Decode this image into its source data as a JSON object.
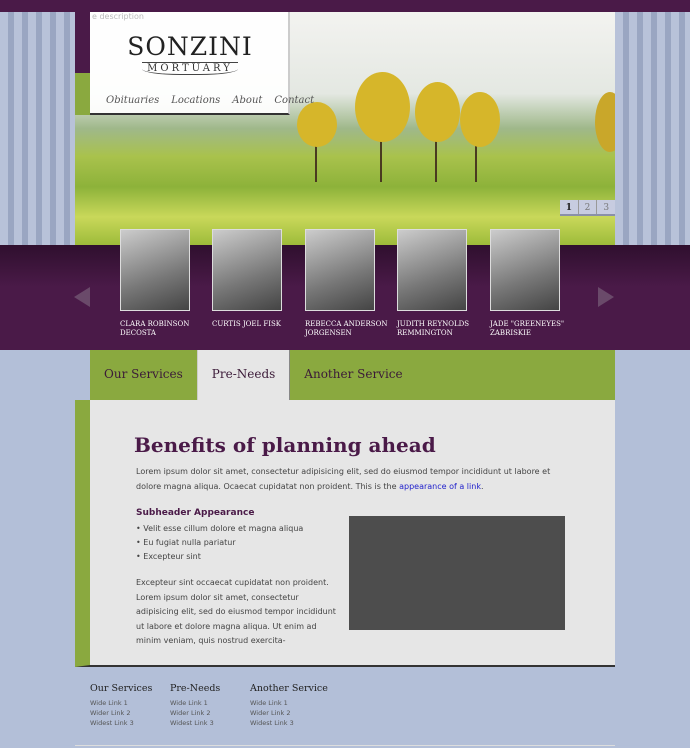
{
  "header": {
    "site_description": "e description",
    "logo_name": "SONZINI",
    "logo_sub": "MORTUARY",
    "nav": [
      "Obituaries",
      "Locations",
      "About",
      "Contact"
    ]
  },
  "slider": {
    "pages": [
      "1",
      "2",
      "3"
    ],
    "current_page": 1
  },
  "obituaries": [
    {
      "name": "CLARA ROBINSON DECOSTA"
    },
    {
      "name": "CURTIS JOEL FISK"
    },
    {
      "name": "REBECCA ANDERSON JORGENSEN"
    },
    {
      "name": "JUDITH REYNOLDS REMMINGTON"
    },
    {
      "name": "JADE \"GREENEYES\" ZABRISKIE"
    }
  ],
  "tabs": [
    {
      "label": "Our Services"
    },
    {
      "label": "Pre-Needs",
      "active": true
    },
    {
      "label": "Another Service"
    }
  ],
  "content": {
    "title": "Benefits of planning ahead",
    "intro": "Lorem ipsum dolor sit amet, consectetur adipisicing elit, sed do eiusmod tempor incididunt ut labore et dolore magna aliqua. Ocaecat cupidatat non proident. This is the ",
    "link": "appearance of a link",
    "intro_end": ".",
    "subheader": "Subheader Appearance",
    "bullets": [
      "• Velit esse cillum dolore et magna aliqua",
      "• Eu fugiat nulla pariatur",
      "• Excepteur sint"
    ],
    "para": "Excepteur sint occaecat cupidatat non proident. Lorem ipsum dolor sit amet, consectetur adipisicing elit, sed do eiusmod tempor incididunt ut labore et dolore magna aliqua. Ut enim ad minim veniam, quis nostrud exercita-"
  },
  "footer": [
    {
      "title": "Our Services",
      "links": [
        "Wide Link 1",
        "Wider Link 2",
        "Widest Link 3"
      ]
    },
    {
      "title": "Pre-Needs",
      "links": [
        "Wide Link 1",
        "Wider Link 2",
        "Widest Link 3"
      ]
    },
    {
      "title": "Another Service",
      "links": [
        "Wide Link 1",
        "Wider Link 2",
        "Widest Link 3"
      ]
    }
  ],
  "colors": {
    "purple": "#4a1a48",
    "green": "#8aa93f",
    "background": "#b3bfd8",
    "link": "#2222cc"
  }
}
